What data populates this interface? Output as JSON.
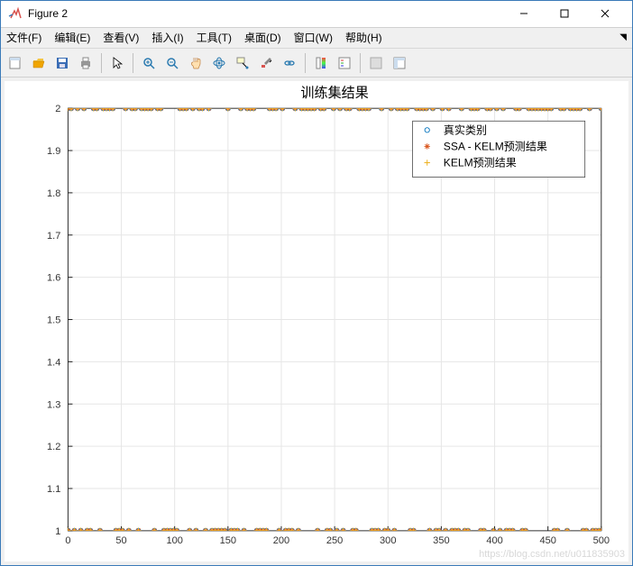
{
  "window": {
    "title": "Figure 2"
  },
  "menu": {
    "file": "文件(F)",
    "edit": "编辑(E)",
    "view": "查看(V)",
    "insert": "插入(I)",
    "tools": "工具(T)",
    "desktop": "桌面(D)",
    "window": "窗口(W)",
    "help": "帮助(H)"
  },
  "watermark": "https://blog.csdn.net/u011835903",
  "chart_data": {
    "type": "scatter",
    "title": "训练集结果",
    "xlabel": "",
    "ylabel": "",
    "xlim": [
      0,
      500
    ],
    "ylim": [
      1,
      2
    ],
    "xticks": [
      0,
      50,
      100,
      150,
      200,
      250,
      300,
      350,
      400,
      450,
      500
    ],
    "yticks": [
      1,
      1.1,
      1.2,
      1.3,
      1.4,
      1.5,
      1.6,
      1.7,
      1.8,
      1.9,
      2
    ],
    "legend": {
      "position": "upper-right-inset",
      "entries": [
        "真实类别",
        "SSA - KELM预测结果",
        "KELM预测结果"
      ]
    },
    "series": [
      {
        "name": "真实类别",
        "marker": "o",
        "color": "#0072BD",
        "description": "Binary class labels (1 or 2) for ~500 samples; dense overlapping markers along y=1 and y=2."
      },
      {
        "name": "SSA - KELM预测结果",
        "marker": "*",
        "color": "#D95319",
        "description": "Predicted labels overlapping the true labels along y=1 and y=2."
      },
      {
        "name": "KELM预测结果",
        "marker": "+",
        "color": "#EDB120",
        "description": "Predicted labels overlapping the true labels along y=1 and y=2."
      }
    ],
    "note": "All three series take only values 1 or 2 across x=0..500 and overlap heavily, forming two dense horizontal bands at y=1 and y=2."
  }
}
